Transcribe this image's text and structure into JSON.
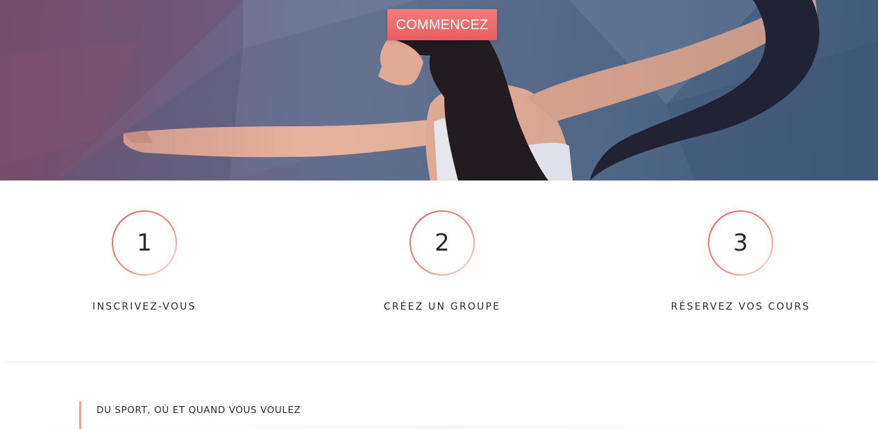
{
  "hero": {
    "cta_label": "COMMENCEZ"
  },
  "steps": [
    {
      "number": "1",
      "label": "INSCRIVEZ-VOUS"
    },
    {
      "number": "2",
      "label": "CRÉEZ UN GROUPE"
    },
    {
      "number": "3",
      "label": "RÉSERVEZ VOS COURS"
    }
  ],
  "tagline": {
    "text": "DU SPORT, OÙ ET QUAND VOUS VOULEZ"
  },
  "colors": {
    "accent": "#ee6b6b",
    "accent_light": "#f2a58f",
    "text": "#2b2b2b"
  }
}
